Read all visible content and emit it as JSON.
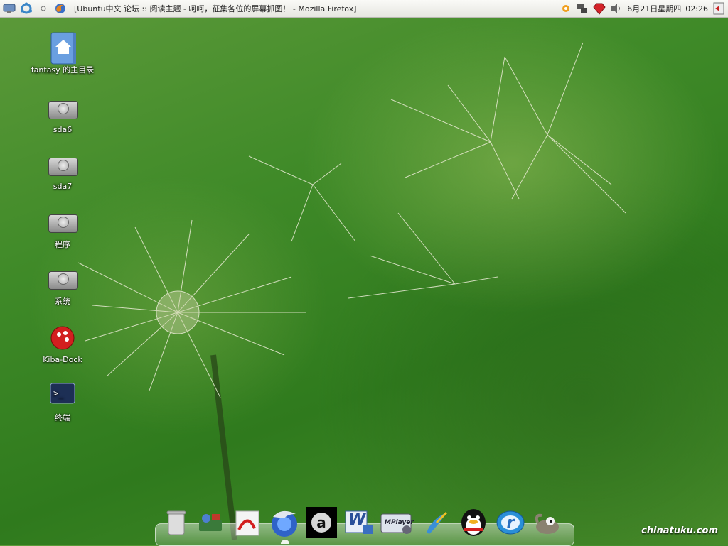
{
  "top_panel": {
    "window_title": "[Ubuntu中文 论坛 :: 阅读主题 - 呵呵，征集各位的屏幕抓图！ - Mozilla Firefox]",
    "clock_date": "6月21日星期四",
    "clock_time": "02:26"
  },
  "desktop_icons": [
    {
      "label": "fantasy 的主目录",
      "icon": "home-folder-icon"
    },
    {
      "label": "sda6",
      "icon": "hard-drive-icon"
    },
    {
      "label": "sda7",
      "icon": "hard-drive-icon"
    },
    {
      "label": "程序",
      "icon": "hard-drive-icon"
    },
    {
      "label": "系统",
      "icon": "hard-drive-icon"
    },
    {
      "label": "Kiba-Dock",
      "icon": "kiba-dock-icon"
    },
    {
      "label": "终端",
      "icon": "terminal-icon"
    }
  ],
  "dock": {
    "items": [
      {
        "name": "trash",
        "icon": "trash-icon"
      },
      {
        "name": "system-tools",
        "icon": "tools-icon"
      },
      {
        "name": "pdf-reader",
        "icon": "pdf-icon"
      },
      {
        "name": "firefox",
        "icon": "firefox-icon"
      },
      {
        "name": "amarok",
        "icon": "amarok-icon",
        "glyph": "a"
      },
      {
        "name": "word-processor",
        "icon": "word-icon",
        "glyph": "W"
      },
      {
        "name": "mplayer",
        "icon": "mplayer-icon",
        "glyph": "MPlayer"
      },
      {
        "name": "editor",
        "icon": "pen-icon"
      },
      {
        "name": "qq",
        "icon": "penguin-icon"
      },
      {
        "name": "realplayer",
        "icon": "realplayer-icon",
        "glyph": "r"
      },
      {
        "name": "gimp",
        "icon": "gimp-icon"
      }
    ]
  },
  "watermark": "chinatuku.com",
  "colors": {
    "panel_bg": "#eeeeea",
    "wallpaper_green": "#3f8a28",
    "kiba_red": "#d21f1f"
  }
}
